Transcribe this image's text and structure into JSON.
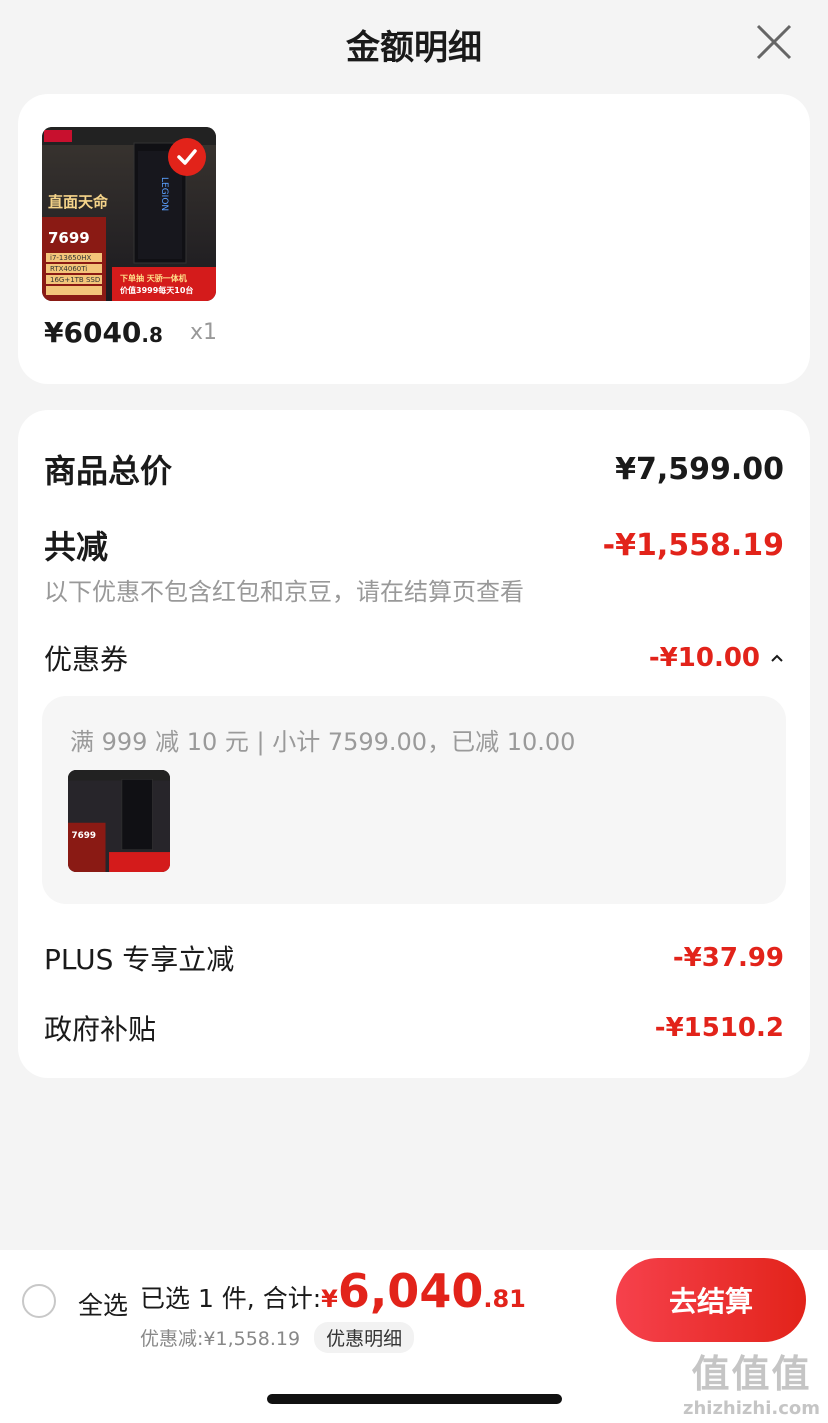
{
  "header": {
    "title": "金额明细"
  },
  "product": {
    "price_main": "¥6040",
    "price_decimal": ".8",
    "quantity": "x1",
    "thumb_price_text": "7699",
    "thumb_brand_text": "LEGION",
    "thumb_slogan": "直面天命",
    "thumb_specs": [
      "i7-13650HX",
      "RTX4060Ti",
      "16G+1TB SSD"
    ],
    "thumb_promo_line1": "下单抽 天骄一体机",
    "thumb_promo_line2": "价值3999每天10台"
  },
  "summary": {
    "total_label": "商品总价",
    "total_value": "¥7,599.00",
    "reduce_label": "共减",
    "reduce_value": "-¥1,558.19",
    "note": "以下优惠不包含红包和京豆，请在结算页查看",
    "coupon_label": "优惠券",
    "coupon_value": "-¥10.00",
    "coupon_detail": "满 999 减 10 元 | 小计 7599.00，已减 10.00",
    "plus_label": "PLUS 专享立减",
    "plus_value": "-¥37.99",
    "subsidy_label": "政府补贴",
    "subsidy_value": "-¥1510.2"
  },
  "footer": {
    "select_all": "全选",
    "selected_text": "已选 1 件, 合计:",
    "total_symbol": "¥",
    "total_int": "6,040",
    "total_dec": ".81",
    "discount_text": "优惠减:¥1,558.19",
    "detail_chip": "优惠明细",
    "checkout": "去结算"
  },
  "watermark": {
    "logo": "值值值",
    "url": "zhizhizhi.com"
  },
  "colors": {
    "accent_red": "#e2231a",
    "background": "#f4f4f4"
  }
}
